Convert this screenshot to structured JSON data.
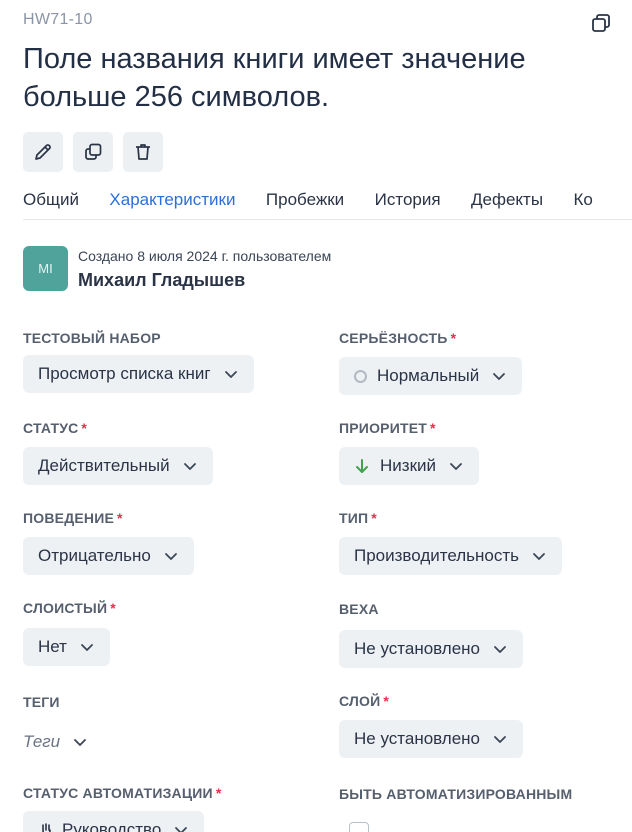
{
  "header": {
    "case_id": "HW71-10",
    "title": "Поле названия книги имеет значение больше 256 символов."
  },
  "tabs": [
    {
      "label": "Общий"
    },
    {
      "label": "Характеристики"
    },
    {
      "label": "Пробежки"
    },
    {
      "label": "История"
    },
    {
      "label": "Дефекты"
    },
    {
      "label": "Ко"
    }
  ],
  "creator": {
    "initials": "MI",
    "created_line": "Создано 8 июля 2024 г. пользователем",
    "name": "Михаил Гладышев"
  },
  "fields": {
    "test_suite": {
      "label": "ТЕСТОВЫЙ НАБОР",
      "value": "Просмотр списка книг"
    },
    "severity": {
      "label": "СЕРЬЁЗНОСТЬ",
      "required": "*",
      "value": "Нормальный"
    },
    "status": {
      "label": "СТАТУС",
      "required": "*",
      "value": "Действительный"
    },
    "priority": {
      "label": "ПРИОРИТЕТ",
      "required": "*",
      "value": "Низкий"
    },
    "behavior": {
      "label": "ПОВЕДЕНИЕ",
      "required": "*",
      "value": "Отрицательно"
    },
    "type": {
      "label": "ТИП",
      "required": "*",
      "value": "Производительность"
    },
    "flaky": {
      "label": "СЛОИСТЫЙ",
      "required": "*",
      "value": "Нет"
    },
    "milestone": {
      "label": "ВЕХА",
      "value": "Не установлено"
    },
    "tags": {
      "label": "ТЕГИ",
      "placeholder": "Теги"
    },
    "layer": {
      "label": "СЛОЙ",
      "required": "*",
      "value": "Не установлено"
    },
    "automation_status": {
      "label": "СТАТУС АВТОМАТИЗАЦИИ",
      "required": "*",
      "value": "Руководство"
    },
    "to_be_automated": {
      "label": "БЫТЬ АВТОМАТИЗИРОВАННЫМ",
      "checked": false
    }
  },
  "colors": {
    "accent": "#2b6fd8",
    "required": "#e0304e",
    "avatar": "#4fa39a",
    "priority_low": "#3fa34d"
  },
  "icons": {
    "window": "restore-window-icon",
    "edit": "pencil-icon",
    "copy": "copy-icon",
    "delete": "trash-icon",
    "chevron": "chevron-down-icon",
    "severity": "circle-icon",
    "priority": "arrow-down-icon",
    "automation": "hand-icon"
  }
}
